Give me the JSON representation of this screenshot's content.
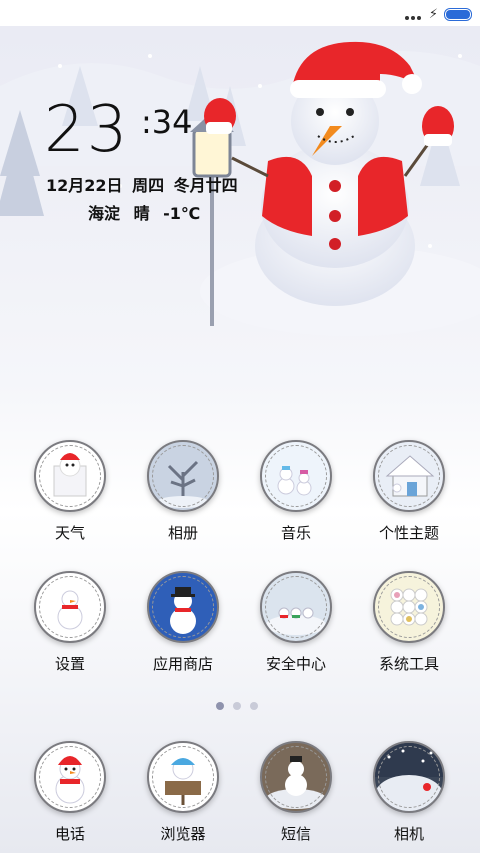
{
  "status_bar": {
    "dots": "•••",
    "charging_symbol": "⚡",
    "battery_level": 1.0
  },
  "clock": {
    "hour": "23",
    "minute": ":34"
  },
  "date_line": "12月22日  周四  冬月廿四",
  "weather_line": "海淀  晴  -1℃",
  "apps": [
    {
      "label": "天气",
      "icon": "snowman-card-icon"
    },
    {
      "label": "相册",
      "icon": "frozen-tree-icon"
    },
    {
      "label": "音乐",
      "icon": "snowmen-scene-icon"
    },
    {
      "label": "个性主题",
      "icon": "snow-house-icon"
    },
    {
      "label": "设置",
      "icon": "snowman-small-icon"
    },
    {
      "label": "应用商店",
      "icon": "snowman-blue-icon"
    },
    {
      "label": "安全中心",
      "icon": "snow-field-icon"
    },
    {
      "label": "系统工具",
      "icon": "app-grid-icon"
    }
  ],
  "dock": [
    {
      "label": "电话",
      "icon": "snowman-red-icon"
    },
    {
      "label": "浏览器",
      "icon": "snowman-sign-icon"
    },
    {
      "label": "短信",
      "icon": "snowman-scene-icon"
    },
    {
      "label": "相机",
      "icon": "winter-landscape-icon"
    }
  ],
  "pager": {
    "pages": 3,
    "active": 1
  },
  "colors": {
    "battery": "#2b6bd8",
    "text": "#111111",
    "santa_red": "#e8262a"
  }
}
